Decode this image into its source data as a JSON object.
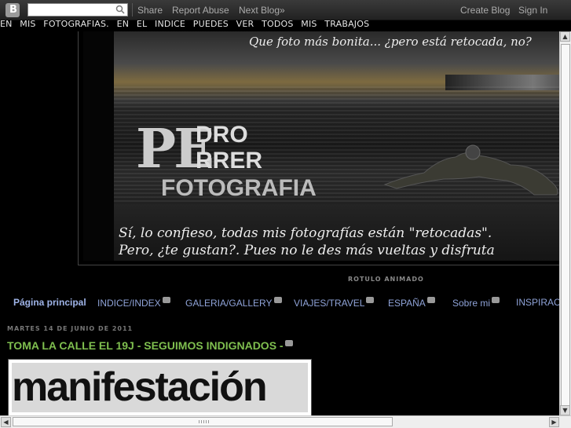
{
  "navbar": {
    "links": {
      "share": "Share",
      "report_abuse": "Report Abuse",
      "next_blog": "Next Blog»",
      "create_blog": "Create Blog",
      "sign_in": "Sign In"
    },
    "search_placeholder": ""
  },
  "marquee_text": "EN MIS FOTOGRAFIAS. EN EL INDICE PUEDES VER TODOS MIS TRABAJOS",
  "header": {
    "top_caption": "Que foto más bonita... ¿pero está retocada, no?",
    "logo": {
      "line1": "DRO",
      "line2": "RRER",
      "line3": "FOTOGRAFIA"
    },
    "bottom_caption_line1": "Sí, lo confieso, todas mis fotografías están \"retocadas\".",
    "bottom_caption_line2": "Pero, ¿te gustan?. Pues no le des más vueltas y disfruta"
  },
  "subtitle": "ROTULO ANIMADO",
  "tabs": [
    {
      "label": "Página principal"
    },
    {
      "label": "INDICE/INDEX"
    },
    {
      "label": "GALERIA/GALLERY"
    },
    {
      "label": "VIAJES/TRAVEL"
    },
    {
      "label": "ESPAÑA"
    },
    {
      "label": "Sobre mi"
    },
    {
      "label": "INSPIRACI"
    }
  ],
  "post": {
    "date": "MARTES 14 DE JUNIO DE 2011",
    "title": "TOMA LA CALLE EL 19J - SEGUIMOS INDIGNADOS -",
    "image_text": "manifestación"
  },
  "colors": {
    "background": "#000000",
    "link_blue": "#8fa3d8",
    "post_title_green": "#7fbf4f",
    "navbar": "#2a2a2a"
  }
}
